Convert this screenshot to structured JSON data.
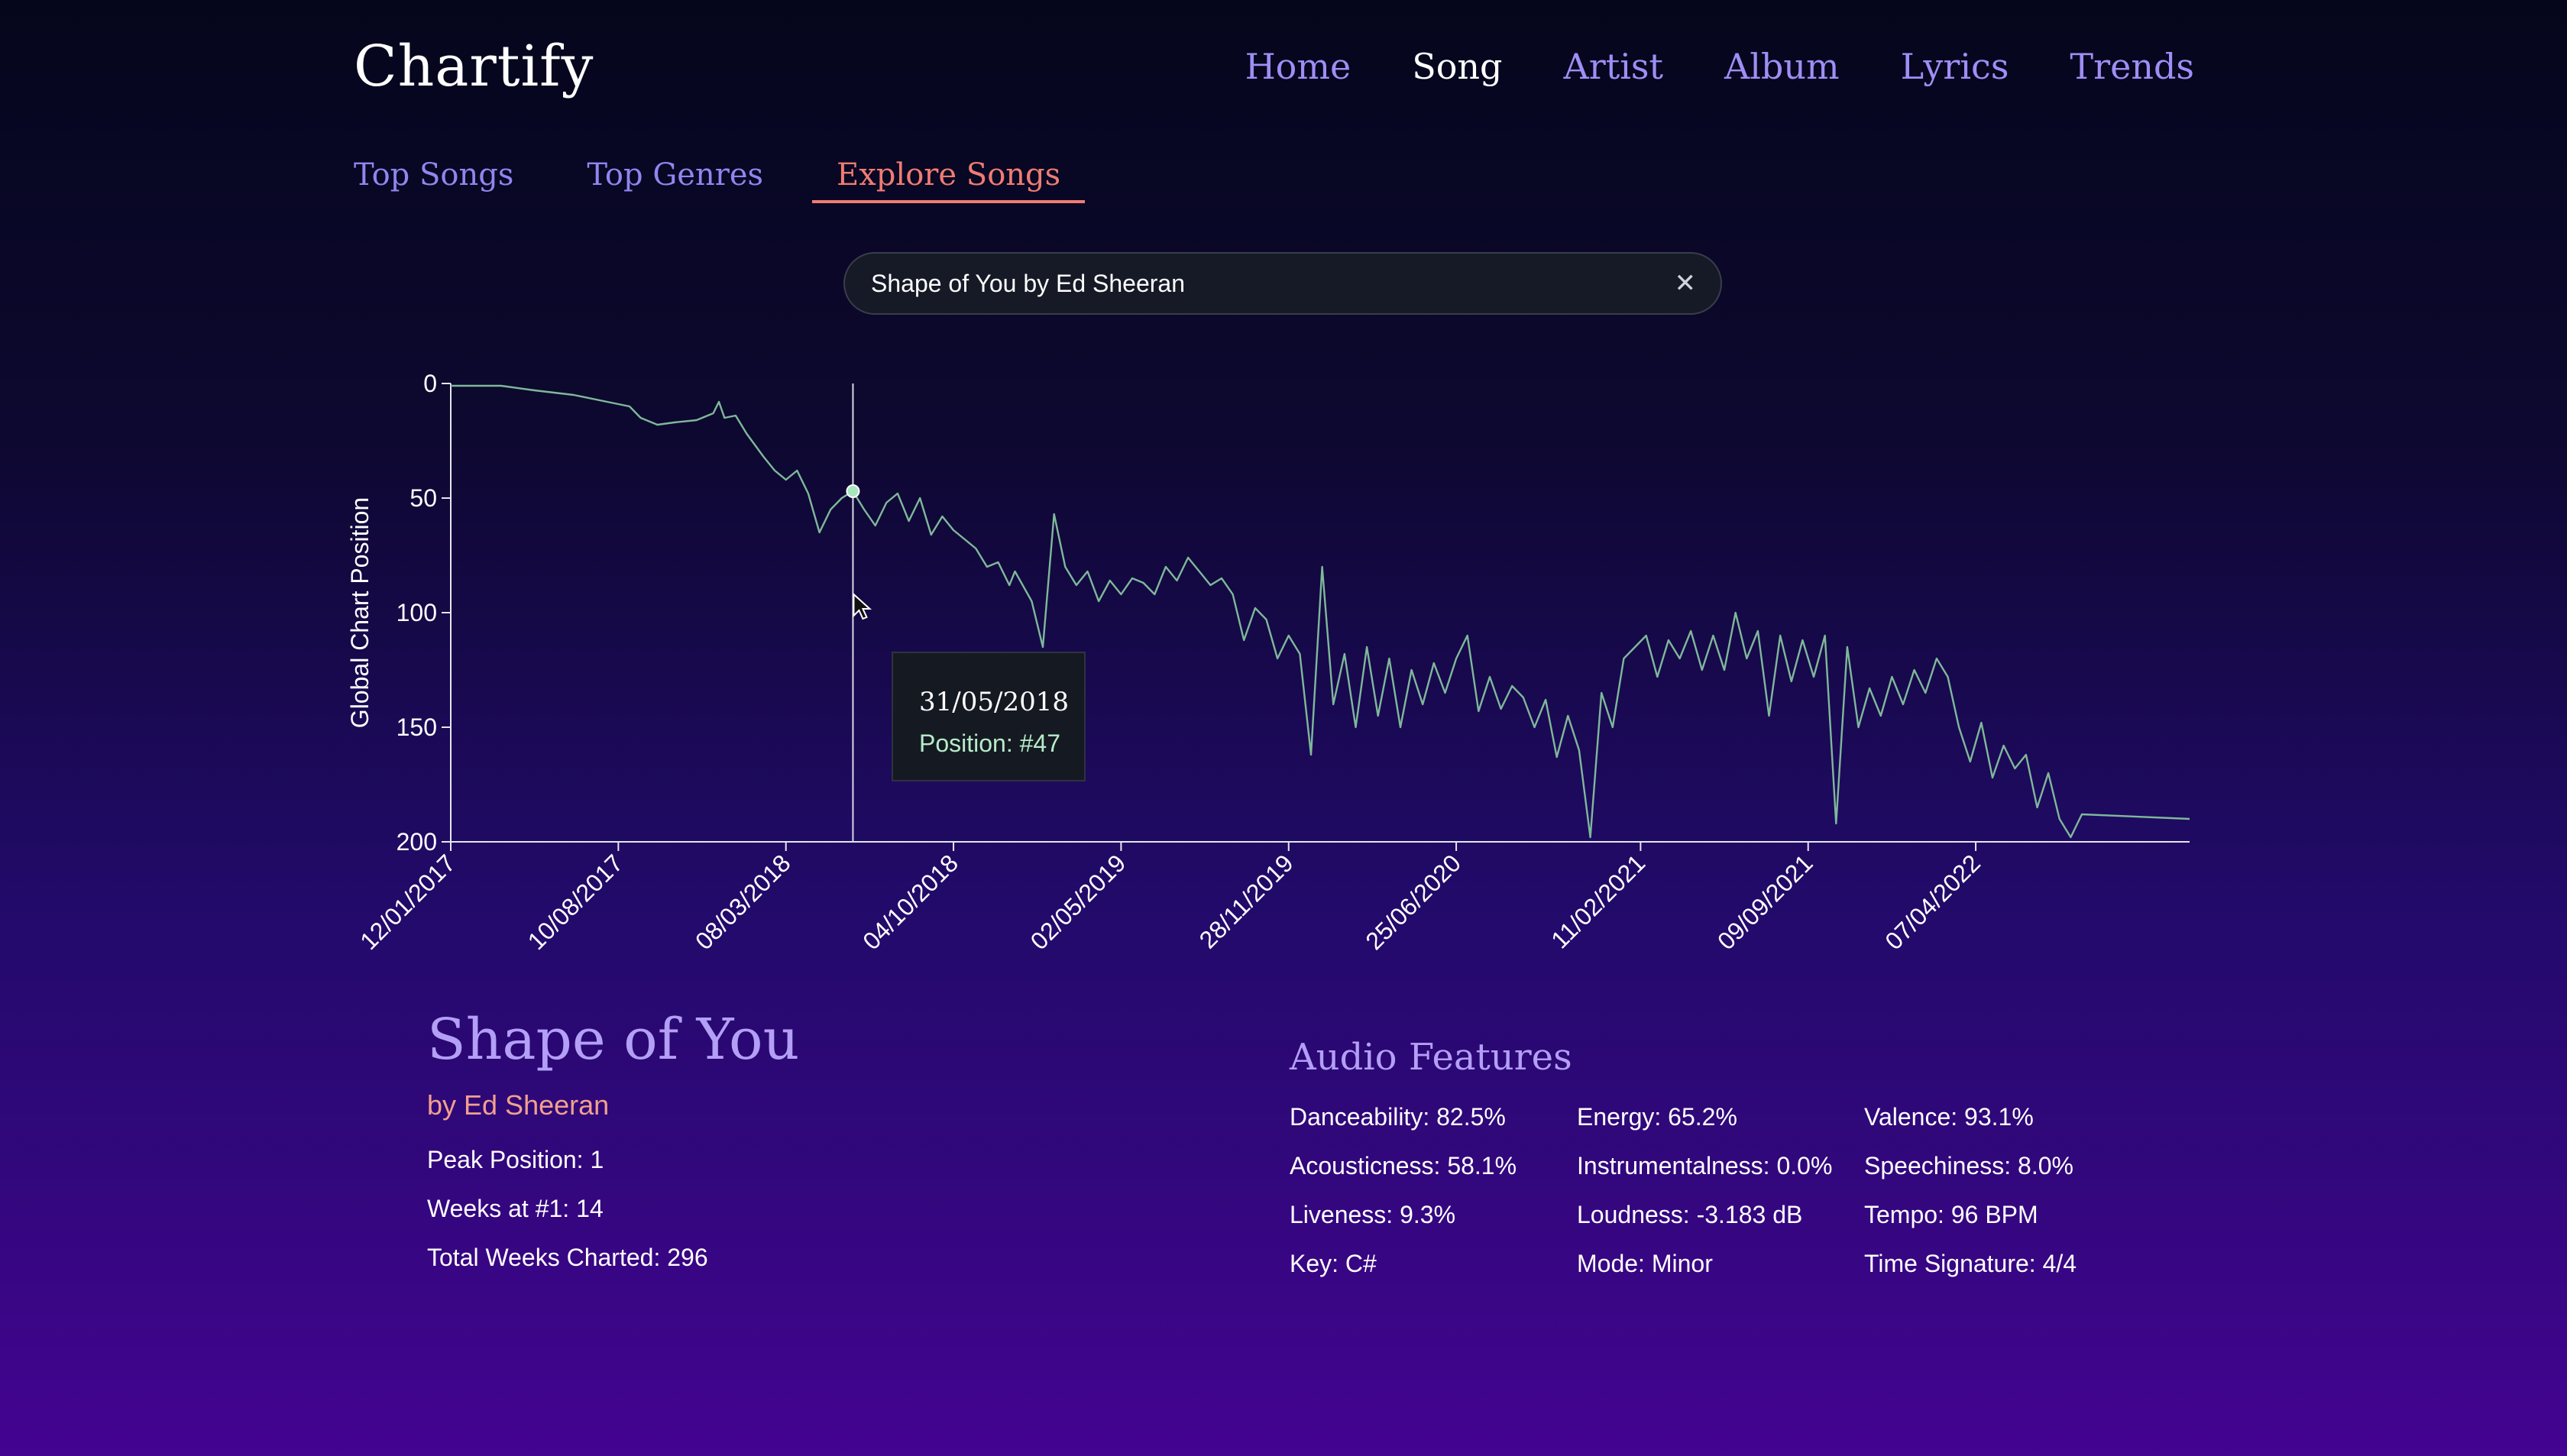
{
  "header": {
    "brand": "Chartify",
    "nav": [
      "Home",
      "Song",
      "Artist",
      "Album",
      "Lyrics",
      "Trends"
    ],
    "active_nav": "Song"
  },
  "subnav": {
    "tabs": [
      "Top Songs",
      "Top Genres",
      "Explore Songs"
    ],
    "active_tab": "Explore Songs"
  },
  "search": {
    "value": "Shape of You by Ed Sheeran",
    "clear_icon": "close-icon"
  },
  "tooltip": {
    "date": "31/05/2018",
    "position": "Position: #47"
  },
  "chart_data": {
    "type": "line",
    "ylabel": "Global Chart Position",
    "xlabel": "",
    "y_reversed": true,
    "ylim": [
      0,
      200
    ],
    "y_ticks": [
      "0",
      "50",
      "100",
      "150",
      "200"
    ],
    "x_range": [
      "2017-01-12",
      "2022-12-31"
    ],
    "x_ticks": [
      "12/01/2017",
      "10/08/2017",
      "08/03/2018",
      "04/10/2018",
      "02/05/2019",
      "28/11/2019",
      "25/06/2020",
      "11/02/2021",
      "09/09/2021",
      "07/04/2022"
    ],
    "line_color": "#7fb89a",
    "highlight": {
      "x": "2018-05-31",
      "y": 47
    },
    "series": [
      {
        "values": [
          [
            "2017-01-12",
            1
          ],
          [
            "2017-03-16",
            1
          ],
          [
            "2017-04-27",
            3
          ],
          [
            "2017-06-15",
            5
          ],
          [
            "2017-07-27",
            8
          ],
          [
            "2017-08-24",
            10
          ],
          [
            "2017-09-07",
            15
          ],
          [
            "2017-09-28",
            18
          ],
          [
            "2017-10-19",
            17
          ],
          [
            "2017-11-16",
            16
          ],
          [
            "2017-12-07",
            13
          ],
          [
            "2017-12-14",
            8
          ],
          [
            "2017-12-21",
            15
          ],
          [
            "2018-01-04",
            14
          ],
          [
            "2018-01-18",
            22
          ],
          [
            "2018-02-08",
            32
          ],
          [
            "2018-02-22",
            38
          ],
          [
            "2018-03-08",
            42
          ],
          [
            "2018-03-22",
            38
          ],
          [
            "2018-04-05",
            48
          ],
          [
            "2018-04-19",
            65
          ],
          [
            "2018-05-03",
            55
          ],
          [
            "2018-05-17",
            50
          ],
          [
            "2018-05-31",
            47
          ],
          [
            "2018-06-14",
            55
          ],
          [
            "2018-06-28",
            62
          ],
          [
            "2018-07-12",
            52
          ],
          [
            "2018-07-26",
            48
          ],
          [
            "2018-08-09",
            60
          ],
          [
            "2018-08-23",
            50
          ],
          [
            "2018-09-06",
            66
          ],
          [
            "2018-09-20",
            58
          ],
          [
            "2018-10-04",
            64
          ],
          [
            "2018-10-18",
            68
          ],
          [
            "2018-11-01",
            72
          ],
          [
            "2018-11-15",
            80
          ],
          [
            "2018-11-29",
            78
          ],
          [
            "2018-12-13",
            88
          ],
          [
            "2018-12-20",
            82
          ],
          [
            "2019-01-10",
            95
          ],
          [
            "2019-01-24",
            115
          ],
          [
            "2019-02-07",
            57
          ],
          [
            "2019-02-21",
            80
          ],
          [
            "2019-03-07",
            88
          ],
          [
            "2019-03-21",
            82
          ],
          [
            "2019-04-04",
            95
          ],
          [
            "2019-04-18",
            86
          ],
          [
            "2019-05-02",
            92
          ],
          [
            "2019-05-16",
            85
          ],
          [
            "2019-05-30",
            87
          ],
          [
            "2019-06-13",
            92
          ],
          [
            "2019-06-27",
            80
          ],
          [
            "2019-07-11",
            86
          ],
          [
            "2019-07-25",
            76
          ],
          [
            "2019-08-08",
            82
          ],
          [
            "2019-08-22",
            88
          ],
          [
            "2019-09-05",
            85
          ],
          [
            "2019-09-19",
            92
          ],
          [
            "2019-10-03",
            112
          ],
          [
            "2019-10-17",
            98
          ],
          [
            "2019-10-31",
            103
          ],
          [
            "2019-11-14",
            120
          ],
          [
            "2019-11-28",
            110
          ],
          [
            "2019-12-12",
            118
          ],
          [
            "2019-12-26",
            162
          ],
          [
            "2020-01-09",
            80
          ],
          [
            "2020-01-23",
            140
          ],
          [
            "2020-02-06",
            118
          ],
          [
            "2020-02-20",
            150
          ],
          [
            "2020-03-05",
            115
          ],
          [
            "2020-03-19",
            145
          ],
          [
            "2020-04-02",
            120
          ],
          [
            "2020-04-16",
            150
          ],
          [
            "2020-04-30",
            125
          ],
          [
            "2020-05-14",
            140
          ],
          [
            "2020-05-28",
            122
          ],
          [
            "2020-06-11",
            135
          ],
          [
            "2020-06-25",
            120
          ],
          [
            "2020-07-09",
            110
          ],
          [
            "2020-07-23",
            143
          ],
          [
            "2020-08-06",
            128
          ],
          [
            "2020-08-20",
            142
          ],
          [
            "2020-09-03",
            132
          ],
          [
            "2020-09-17",
            137
          ],
          [
            "2020-10-01",
            150
          ],
          [
            "2020-10-15",
            138
          ],
          [
            "2020-10-29",
            163
          ],
          [
            "2020-11-12",
            145
          ],
          [
            "2020-11-26",
            160
          ],
          [
            "2020-12-10",
            198
          ],
          [
            "2020-12-24",
            135
          ],
          [
            "2021-01-07",
            150
          ],
          [
            "2021-01-21",
            120
          ],
          [
            "2021-02-04",
            115
          ],
          [
            "2021-02-18",
            110
          ],
          [
            "2021-03-04",
            128
          ],
          [
            "2021-03-18",
            112
          ],
          [
            "2021-04-01",
            120
          ],
          [
            "2021-04-15",
            108
          ],
          [
            "2021-04-29",
            125
          ],
          [
            "2021-05-13",
            110
          ],
          [
            "2021-05-27",
            125
          ],
          [
            "2021-06-10",
            100
          ],
          [
            "2021-06-24",
            120
          ],
          [
            "2021-07-08",
            108
          ],
          [
            "2021-07-22",
            145
          ],
          [
            "2021-08-05",
            110
          ],
          [
            "2021-08-19",
            130
          ],
          [
            "2021-09-02",
            112
          ],
          [
            "2021-09-16",
            128
          ],
          [
            "2021-09-30",
            110
          ],
          [
            "2021-10-14",
            192
          ],
          [
            "2021-10-28",
            115
          ],
          [
            "2021-11-11",
            150
          ],
          [
            "2021-11-25",
            133
          ],
          [
            "2021-12-09",
            145
          ],
          [
            "2021-12-23",
            128
          ],
          [
            "2022-01-06",
            140
          ],
          [
            "2022-01-20",
            125
          ],
          [
            "2022-02-03",
            135
          ],
          [
            "2022-02-17",
            120
          ],
          [
            "2022-03-03",
            128
          ],
          [
            "2022-03-17",
            150
          ],
          [
            "2022-03-31",
            165
          ],
          [
            "2022-04-14",
            148
          ],
          [
            "2022-04-28",
            172
          ],
          [
            "2022-05-12",
            158
          ],
          [
            "2022-05-26",
            168
          ],
          [
            "2022-06-09",
            162
          ],
          [
            "2022-06-23",
            185
          ],
          [
            "2022-07-07",
            170
          ],
          [
            "2022-07-21",
            190
          ],
          [
            "2022-08-04",
            198
          ],
          [
            "2022-08-18",
            188
          ],
          [
            "2022-12-31",
            190
          ]
        ]
      }
    ]
  },
  "song": {
    "title": "Shape of You",
    "artist": "by Ed Sheeran",
    "peak": "Peak Position: 1",
    "weeks_at_one": "Weeks at #1: 14",
    "total_weeks": "Total Weeks Charted: 296"
  },
  "audio_features": {
    "heading": "Audio Features",
    "items": [
      "Danceability: 82.5%",
      "Energy: 65.2%",
      "Valence: 93.1%",
      "Acousticness: 58.1%",
      "Instrumentalness: 0.0%",
      "Speechiness: 8.0%",
      "Liveness: 9.3%",
      "Loudness: -3.183 dB",
      "Tempo: 96 BPM",
      "Key: C#",
      "Mode: Minor",
      "Time Signature: 4/4"
    ]
  }
}
